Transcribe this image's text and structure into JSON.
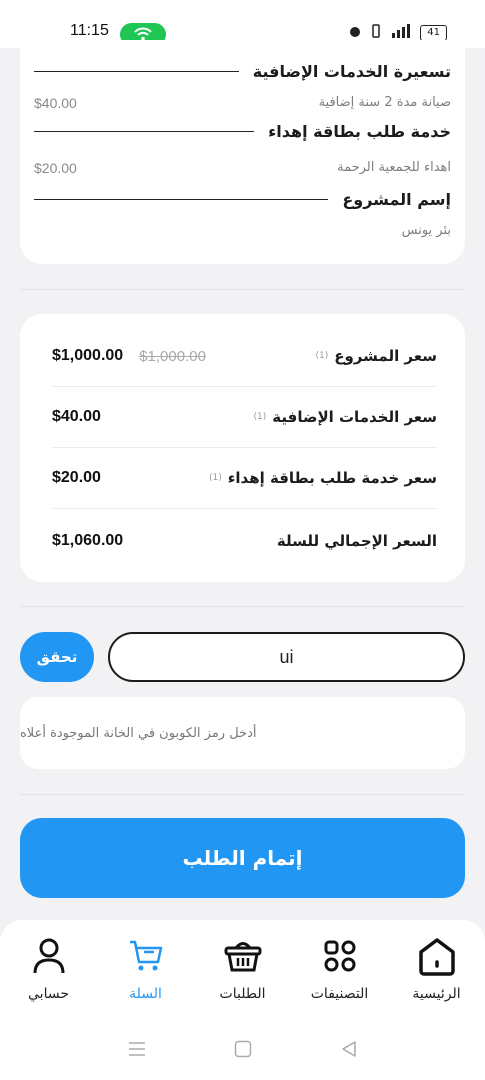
{
  "status_bar": {
    "time": "11:15",
    "battery": "41"
  },
  "order_details": [
    {
      "title": "تسعيرة الخدمات الإضافية",
      "detail": "صيانة مدة 2 سنة إضافية",
      "price": "$40.00"
    },
    {
      "title": "خدمة طلب بطاقة إهداء",
      "detail": "اهداء للجمعية الرحمة",
      "price": "$20.00"
    },
    {
      "title": "إسم المشروع",
      "detail": "بئر يونس",
      "price": ""
    }
  ],
  "summary": {
    "project_price": {
      "label": "سعر المشروع",
      "qty": "(1)",
      "value": "$1,000.00",
      "old_value": "$1,000.00"
    },
    "services_price": {
      "label": "سعر الخدمات الإضافية",
      "qty": "(1)",
      "value": "$40.00"
    },
    "gift_price": {
      "label": "سعر خدمة طلب بطاقة إهداء",
      "qty": "(1)",
      "value": "$20.00"
    },
    "total": {
      "label": "السعر الإجمالي للسلة",
      "value": "$1,060.00"
    }
  },
  "coupon": {
    "value": "ui",
    "verify_label": "تحقق",
    "hint": "أدخل رمز الكوبون في الخانة الموجودة أعلاه"
  },
  "checkout_label": "إتمام الطلب",
  "nav": {
    "home": "الرئيسية",
    "categories": "التصنيفات",
    "orders": "الطلبات",
    "cart": "السلة",
    "account": "حسابي"
  },
  "colors": {
    "accent": "#2196f3",
    "status_green": "#1fc654"
  }
}
